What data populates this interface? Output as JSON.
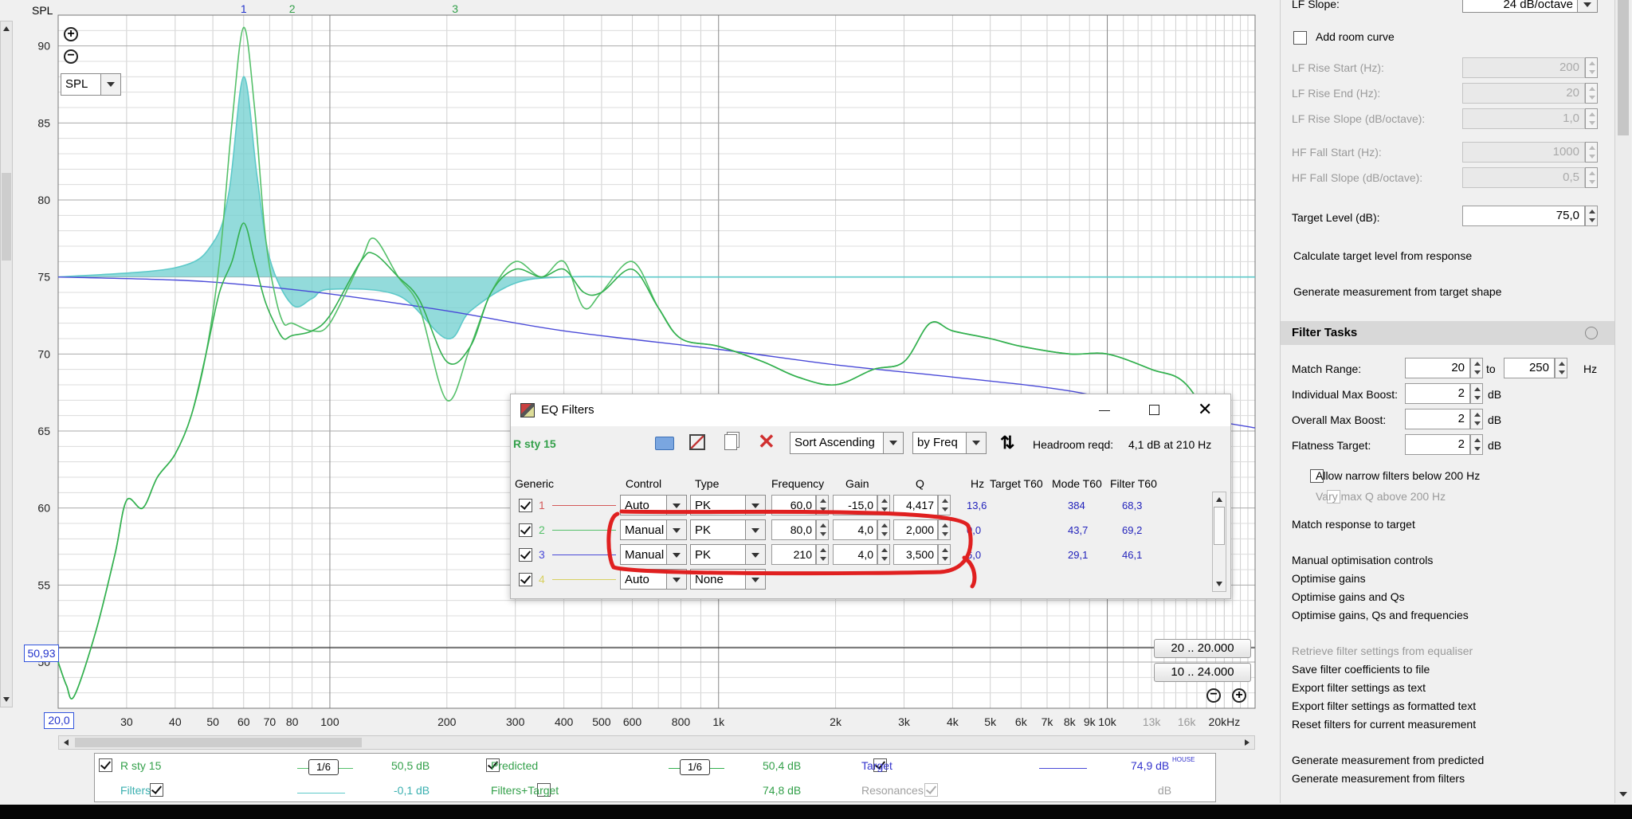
{
  "graph": {
    "y_axis_title": "SPL",
    "y_ticks": [
      "90",
      "85",
      "80",
      "75",
      "70",
      "65",
      "60",
      "55",
      "50"
    ],
    "y_cursor_value": "50,93",
    "x_cursor_value": "20,0",
    "x_ticks": [
      "30",
      "40",
      "50",
      "60",
      "70",
      "80",
      "100",
      "200",
      "300",
      "400",
      "500",
      "600",
      "800",
      "1k",
      "2k",
      "3k",
      "4k",
      "5k",
      "6k",
      "7k",
      "8k",
      "9k",
      "10k",
      "13k",
      "16k",
      "20kHz"
    ],
    "filter_markers": [
      "1",
      "2",
      "3"
    ],
    "mode_select": "SPL",
    "range_buttons": [
      "20 .. 20.000",
      "10 .. 24.000"
    ],
    "colors": {
      "measurement": "#55c06a",
      "predicted": "#33b04f",
      "target": "#4a4ad8",
      "filters": "#5ec9c9",
      "filter_fill": "#6fcfcf"
    }
  },
  "chart_data": {
    "type": "line",
    "x_scale": "log",
    "xlim": [
      20,
      24000
    ],
    "ylim": [
      47,
      92
    ],
    "xlabel": "",
    "ylabel": "SPL",
    "series": [
      {
        "name": "Target",
        "x": [
          20,
          40,
          60,
          100,
          200,
          400,
          1000,
          2000,
          4000,
          8000,
          16000,
          24000
        ],
        "y": [
          75,
          74.8,
          74.5,
          73.9,
          72.8,
          71.5,
          70.3,
          69.3,
          68.5,
          67.6,
          66,
          65.2
        ]
      },
      {
        "name": "Filters+Target",
        "x": [
          20,
          40,
          50,
          55,
          60,
          65,
          70,
          80,
          90,
          100,
          150,
          200,
          230,
          300,
          400,
          600,
          1000,
          24000
        ],
        "y": [
          75,
          75.6,
          77.2,
          80.5,
          88,
          81.5,
          76.2,
          73.2,
          73.6,
          74.2,
          73.8,
          71,
          72.8,
          74.6,
          75,
          75,
          75,
          75
        ]
      },
      {
        "name": "R sty 15",
        "x": [
          20,
          21,
          22,
          25,
          28,
          30,
          33,
          36,
          40,
          44,
          48,
          52,
          56,
          60,
          64,
          68,
          72,
          76,
          80,
          90,
          100,
          120,
          130,
          150,
          170,
          200,
          230,
          260,
          300,
          350,
          400,
          450,
          500,
          600,
          700,
          800,
          1000,
          1300,
          1600,
          2000,
          2500,
          3000,
          3500,
          4000,
          5000,
          6000,
          8000,
          10000,
          13000,
          16000,
          20000
        ],
        "y": [
          50,
          48.5,
          47.8,
          52,
          57,
          60.5,
          60,
          62,
          63.5,
          66,
          70,
          76,
          85,
          91.2,
          86,
          78,
          74,
          72,
          72,
          71.5,
          72,
          76,
          77.5,
          75,
          73,
          67,
          70.5,
          74,
          76,
          75,
          76,
          73,
          74,
          76,
          73,
          71,
          70.5,
          69.5,
          68.5,
          68,
          69,
          69.5,
          72,
          71.5,
          71,
          70.5,
          70,
          70,
          69,
          68,
          64
        ]
      },
      {
        "name": "Predicted",
        "x": [
          20,
          21,
          22,
          25,
          28,
          30,
          33,
          36,
          40,
          44,
          48,
          52,
          56,
          60,
          64,
          68,
          72,
          76,
          80,
          90,
          100,
          120,
          130,
          150,
          170,
          200,
          230,
          260,
          300,
          350,
          400,
          450,
          500,
          600,
          700,
          800,
          1000,
          1300,
          1600,
          2000,
          2500,
          3000,
          3500,
          4000,
          5000,
          6000,
          8000,
          10000,
          13000,
          16000,
          20000
        ],
        "y": [
          50,
          48.5,
          47.8,
          52,
          57,
          60.5,
          60,
          62,
          63.5,
          66,
          70,
          74,
          76,
          78.5,
          76,
          73.5,
          72,
          71,
          71.2,
          71.5,
          72.5,
          76,
          76.5,
          75,
          73.5,
          69.5,
          70.5,
          74,
          75.5,
          75,
          75.5,
          74,
          74,
          75.5,
          73,
          71,
          70.5,
          69.5,
          68.5,
          68,
          69,
          69.5,
          72,
          71.5,
          71,
          70.5,
          70,
          70,
          69,
          68,
          64
        ]
      }
    ]
  },
  "eq_window": {
    "title": "EQ Filters",
    "meas_name": "R sty 15",
    "sort_select": "Sort Ascending",
    "by_select": "by Freq",
    "headroom_label": "Headroom reqd:",
    "headroom_value": "4,1 dB at 210 Hz",
    "columns": {
      "generic": "Generic",
      "control": "Control",
      "type": "Type",
      "frequency": "Frequency",
      "gain": "Gain",
      "q": "Q",
      "hz": "Hz",
      "target_t60": "Target T60",
      "mode_t60": "Mode T60",
      "filter_t60": "Filter T60"
    },
    "rows": [
      {
        "num": "1",
        "color": "#d45a5a",
        "control": "Auto",
        "type": "PK",
        "freq": "60,0",
        "gain": "-15,0",
        "q": "4,417",
        "hz": "13,6",
        "mode_t60": "384",
        "filter_t60": "68,3"
      },
      {
        "num": "2",
        "color": "#55c06a",
        "control": "Manual",
        "type": "PK",
        "freq": "80,0",
        "gain": "4,0",
        "q": "2,000",
        "hz": "0,0",
        "mode_t60": "43,7",
        "filter_t60": "69,2"
      },
      {
        "num": "3",
        "color": "#4a4ad8",
        "control": "Manual",
        "type": "PK",
        "freq": "210",
        "gain": "4,0",
        "q": "3,500",
        "hz": "6,0",
        "mode_t60": "29,1",
        "filter_t60": "46,1"
      },
      {
        "num": "4",
        "color": "#d8d060",
        "control": "Auto",
        "type": "None"
      }
    ]
  },
  "right_panel": {
    "lf_slope_label": "LF Slope:",
    "lf_slope_value": "24 dB/octave",
    "add_room_curve": "Add room curve",
    "lf_rise_start_label": "LF Rise Start (Hz):",
    "lf_rise_start": "200",
    "lf_rise_end_label": "LF Rise End (Hz):",
    "lf_rise_end": "20",
    "lf_rise_slope_label": "LF Rise Slope (dB/octave):",
    "lf_rise_slope": "1,0",
    "hf_fall_start_label": "HF Fall Start (Hz):",
    "hf_fall_start": "1000",
    "hf_fall_slope_label": "HF Fall Slope (dB/octave):",
    "hf_fall_slope": "0,5",
    "target_level_label": "Target Level (dB):",
    "target_level": "75,0",
    "calc_target": "Calculate target level from response",
    "gen_from_target": "Generate measurement from target shape",
    "filter_tasks_title": "Filter Tasks",
    "match_range_label": "Match Range:",
    "match_range_low": "20",
    "match_range_to": "to",
    "match_range_high": "250",
    "match_range_unit": "Hz",
    "ind_boost_label": "Individual Max Boost:",
    "ind_boost": "2",
    "ind_boost_unit": "dB",
    "overall_boost_label": "Overall Max Boost:",
    "overall_boost": "2",
    "overall_boost_unit": "dB",
    "flatness_label": "Flatness Target:",
    "flatness": "2",
    "flatness_unit": "dB",
    "allow_narrow": "Allow narrow filters below 200 Hz",
    "vary_q": "Vary max Q above 200 Hz",
    "match_response": "Match response to target",
    "manual_opt": "Manual optimisation controls",
    "opt_gains": "Optimise gains",
    "opt_gains_qs": "Optimise gains and Qs",
    "opt_all": "Optimise gains, Qs and frequencies",
    "retrieve": "Retrieve filter settings from equaliser",
    "save_coeffs": "Save filter coefficients to file",
    "export_text": "Export filter settings as text",
    "export_formatted": "Export filter settings as formatted text",
    "reset_filters": "Reset filters for current measurement",
    "gen_predicted": "Generate measurement from predicted",
    "gen_filters": "Generate measurement from filters"
  },
  "legend": {
    "r_sty": {
      "label": "R sty 15",
      "smooth": "1/6",
      "value": "50,5 dB"
    },
    "predicted": {
      "label": "Predicted",
      "smooth": "1/6",
      "value": "50,4 dB"
    },
    "target": {
      "label": "Target",
      "value": "74,9 dB",
      "sup": "HOUSE"
    },
    "filters": {
      "label": "Filters",
      "value": "-0,1 dB"
    },
    "filters_target": {
      "label": "Filters+Target",
      "value": "74,8 dB"
    },
    "resonances": {
      "label": "Resonances",
      "value": "dB"
    }
  }
}
